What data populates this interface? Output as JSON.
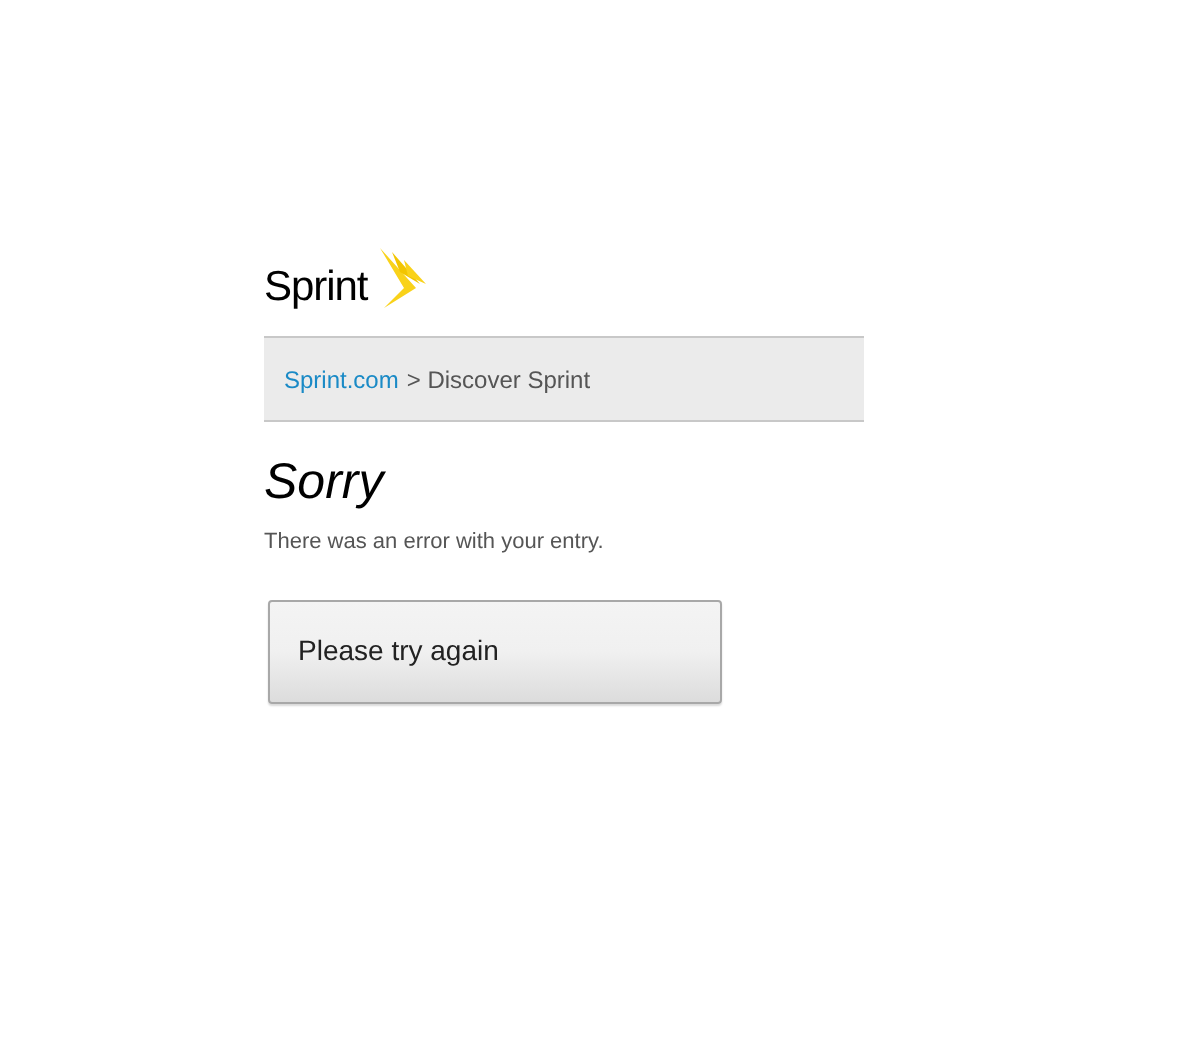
{
  "logo": {
    "text": "Sprint"
  },
  "breadcrumb": [
    {
      "label": "Sprint.com",
      "kind": "link"
    },
    {
      "label": "> Discover Sprint",
      "kind": "current"
    }
  ],
  "heading": "Sorry",
  "message": "There was an error with your entry.",
  "button": {
    "label": "Please try again"
  }
}
